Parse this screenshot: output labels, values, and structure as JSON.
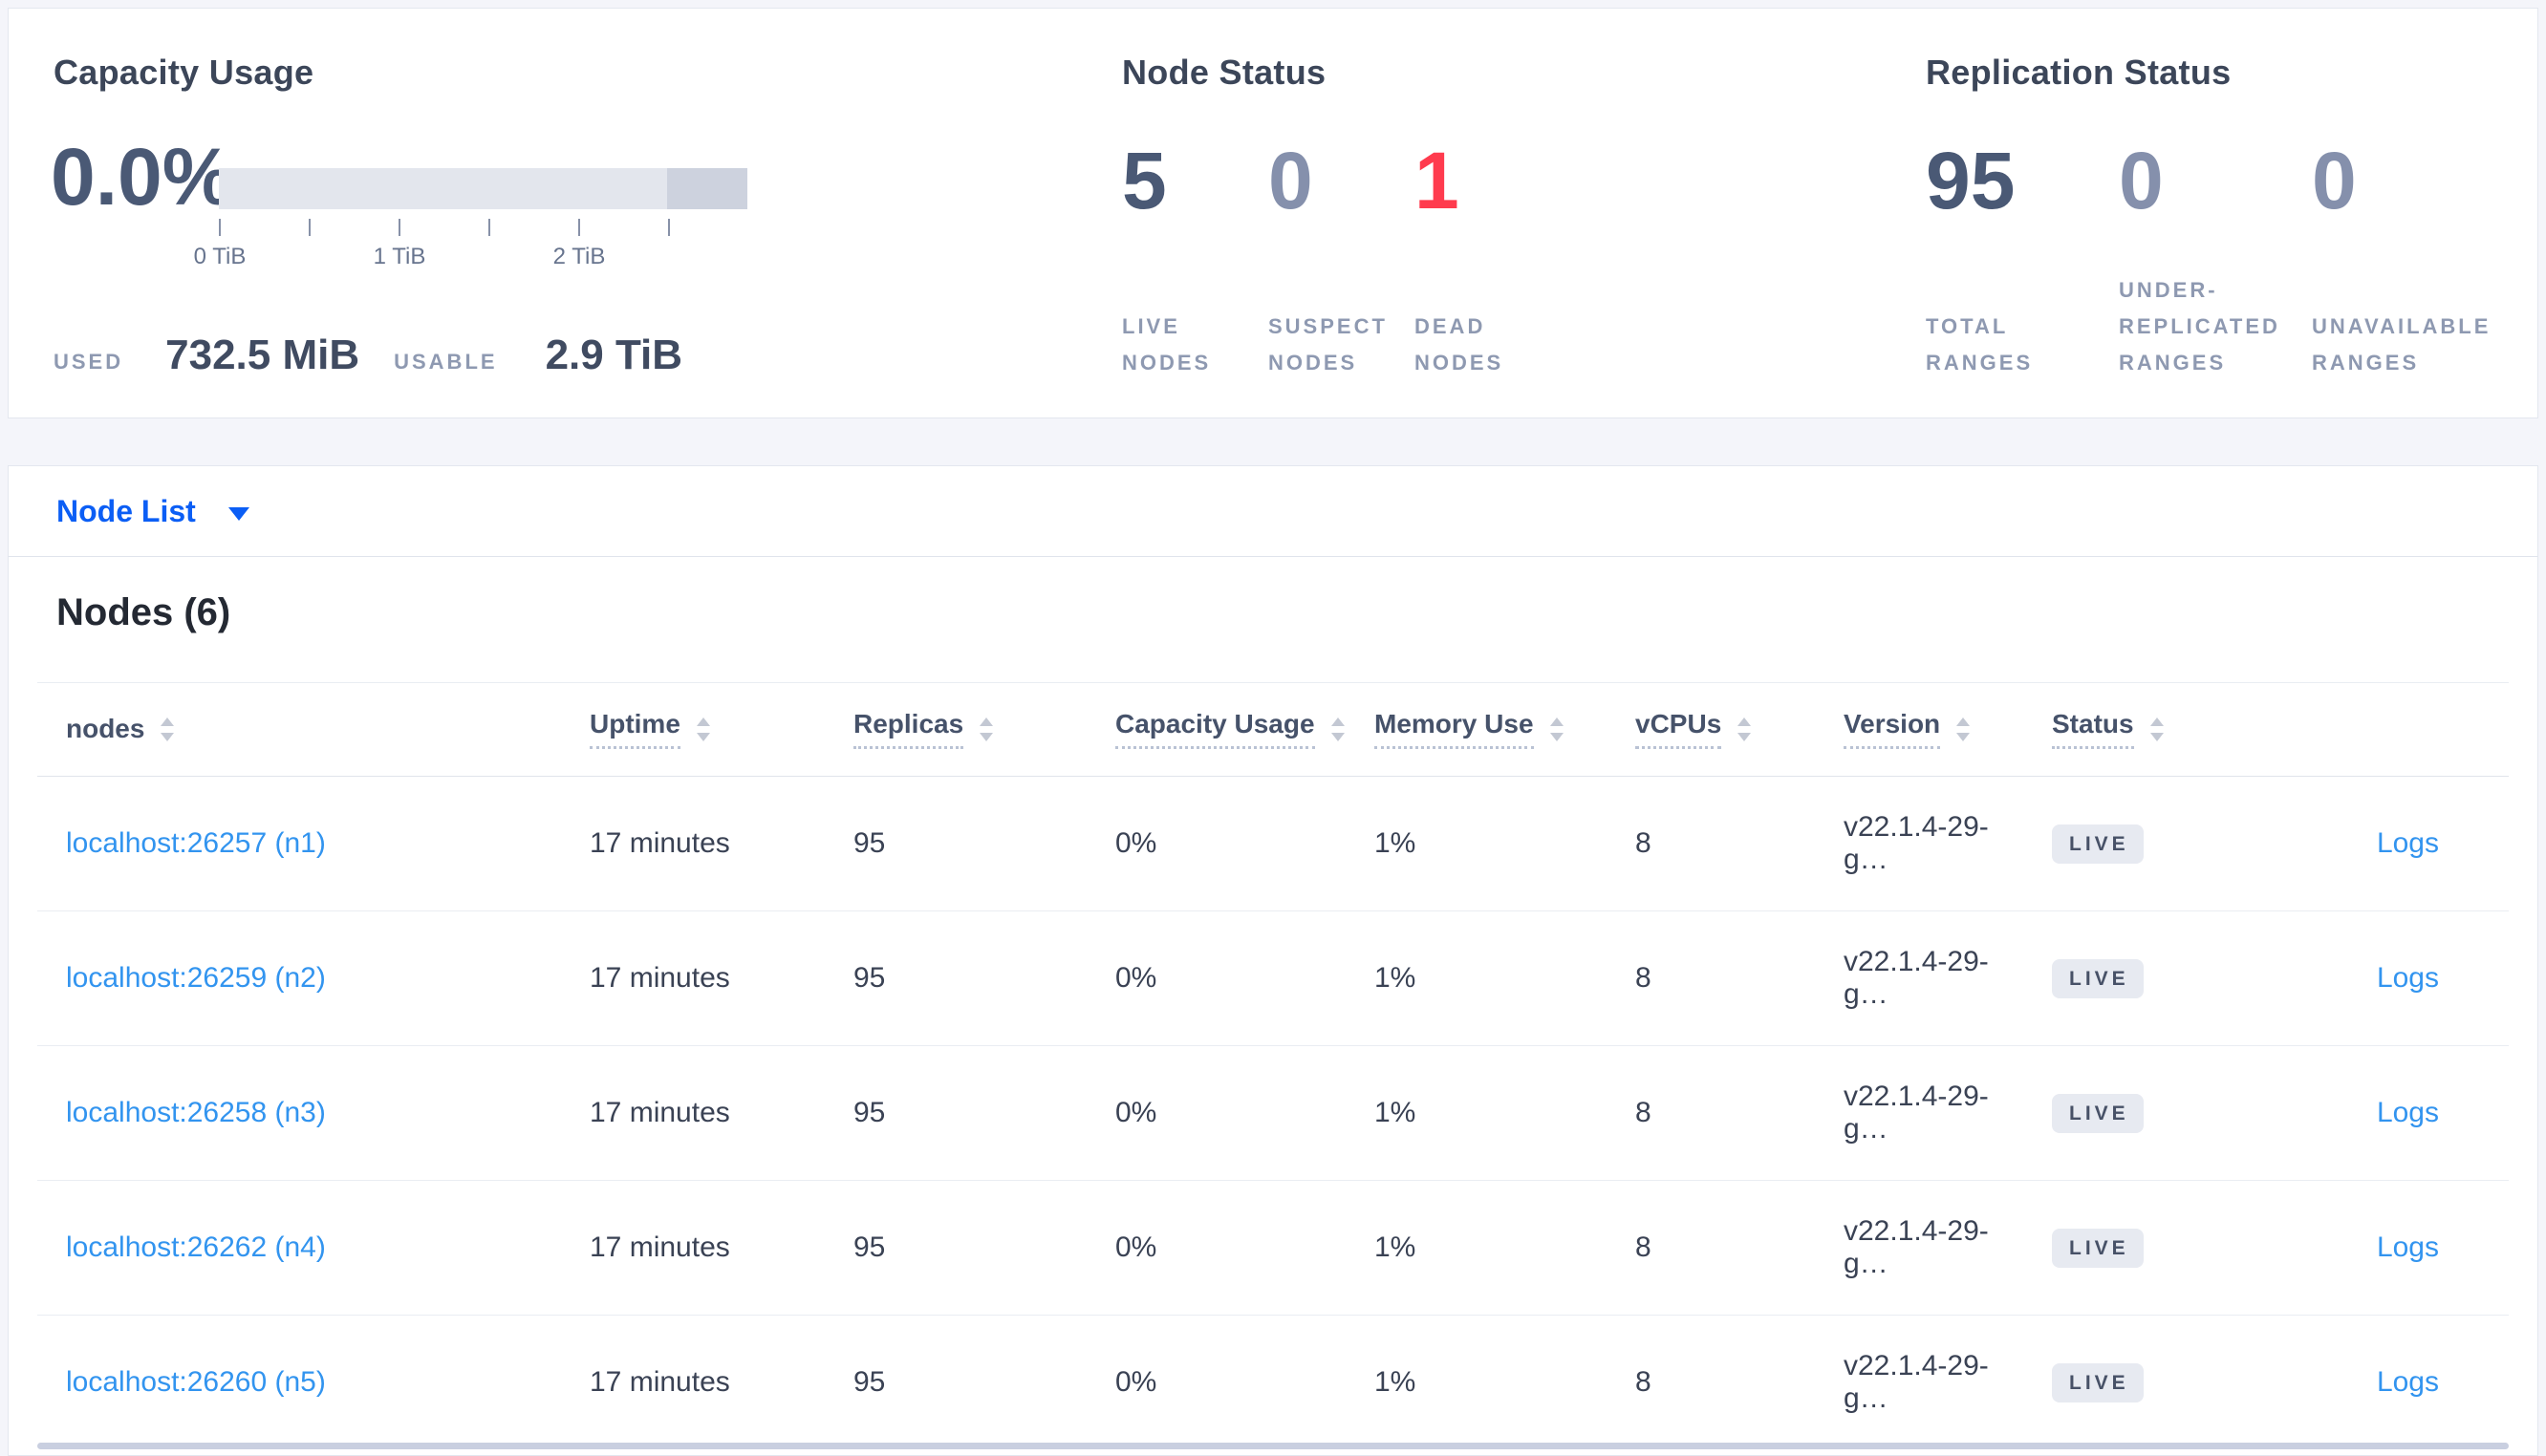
{
  "summary": {
    "capacity": {
      "title": "Capacity Usage",
      "percent": "0.0%",
      "axis_ticks": [
        "0 TiB",
        "1 TiB",
        "2 TiB"
      ],
      "used_label": "USED",
      "used_value": "732.5 MiB",
      "usable_label": "USABLE",
      "usable_value": "2.9 TiB"
    },
    "node_status": {
      "title": "Node Status",
      "metrics": [
        {
          "value": "5",
          "label": "LIVE NODES",
          "emphasis": "strong"
        },
        {
          "value": "0",
          "label": "SUSPECT NODES",
          "emphasis": "muted"
        },
        {
          "value": "1",
          "label": "DEAD NODES",
          "emphasis": "danger"
        }
      ]
    },
    "replication": {
      "title": "Replication Status",
      "metrics": [
        {
          "value": "95",
          "label": "TOTAL RANGES",
          "emphasis": "strong"
        },
        {
          "value": "0",
          "label": "UNDER-REPLICATED RANGES",
          "emphasis": "muted"
        },
        {
          "value": "0",
          "label": "UNAVAILABLE RANGES",
          "emphasis": "muted"
        }
      ]
    }
  },
  "view_selector": {
    "label": "Node List"
  },
  "nodes_section": {
    "heading": "Nodes (6)",
    "columns": [
      {
        "label": "nodes",
        "underlined": false
      },
      {
        "label": "Uptime",
        "underlined": true
      },
      {
        "label": "Replicas",
        "underlined": true
      },
      {
        "label": "Capacity Usage",
        "underlined": true
      },
      {
        "label": "Memory Use",
        "underlined": true
      },
      {
        "label": "vCPUs",
        "underlined": true
      },
      {
        "label": "Version",
        "underlined": true
      },
      {
        "label": "Status",
        "underlined": true
      }
    ],
    "rows": [
      {
        "node": "localhost:26257 (n1)",
        "uptime": "17 minutes",
        "replicas": "95",
        "capacity": "0%",
        "memory": "1%",
        "vcpus": "8",
        "version": "v22.1.4-29-g…",
        "status": "LIVE",
        "logs": "Logs"
      },
      {
        "node": "localhost:26259 (n2)",
        "uptime": "17 minutes",
        "replicas": "95",
        "capacity": "0%",
        "memory": "1%",
        "vcpus": "8",
        "version": "v22.1.4-29-g…",
        "status": "LIVE",
        "logs": "Logs"
      },
      {
        "node": "localhost:26258 (n3)",
        "uptime": "17 minutes",
        "replicas": "95",
        "capacity": "0%",
        "memory": "1%",
        "vcpus": "8",
        "version": "v22.1.4-29-g…",
        "status": "LIVE",
        "logs": "Logs"
      },
      {
        "node": "localhost:26262 (n4)",
        "uptime": "17 minutes",
        "replicas": "95",
        "capacity": "0%",
        "memory": "1%",
        "vcpus": "8",
        "version": "v22.1.4-29-g…",
        "status": "LIVE",
        "logs": "Logs"
      },
      {
        "node": "localhost:26260 (n5)",
        "uptime": "17 minutes",
        "replicas": "95",
        "capacity": "0%",
        "memory": "1%",
        "vcpus": "8",
        "version": "v22.1.4-29-g…",
        "status": "LIVE",
        "logs": "Logs"
      }
    ]
  }
}
